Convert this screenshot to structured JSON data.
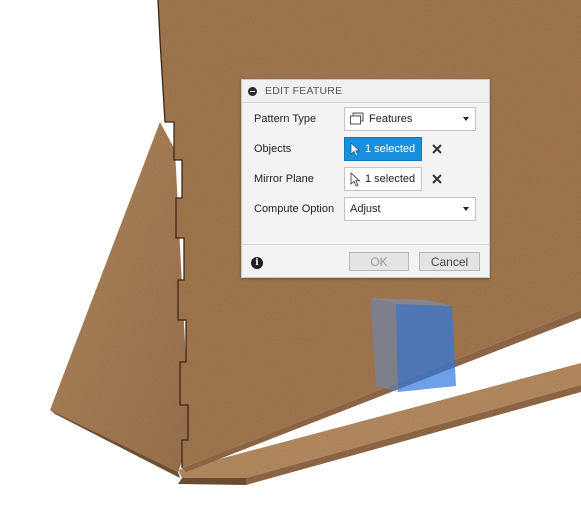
{
  "dialog": {
    "title": "EDIT FEATURE",
    "pattern_type": {
      "label": "Pattern Type",
      "value": "Features"
    },
    "objects": {
      "label": "Objects",
      "value": "1 selected"
    },
    "mirror_plane": {
      "label": "Mirror Plane",
      "value": "1 selected"
    },
    "compute_option": {
      "label": "Compute Option",
      "value": "Adjust"
    },
    "ok_label": "OK",
    "cancel_label": "Cancel"
  },
  "colors": {
    "wood": "#a98057",
    "wood_dark": "#7d5a3a",
    "selection_blue": "#1a8fdc",
    "mirror_plane_preview": "#3c7fe0"
  }
}
